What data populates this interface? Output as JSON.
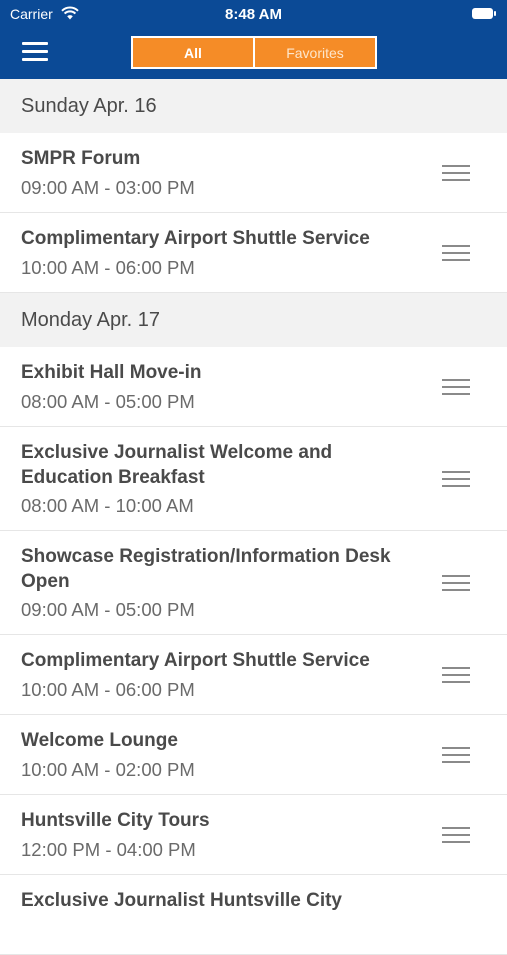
{
  "status_bar": {
    "carrier": "Carrier",
    "time": "8:48 AM"
  },
  "nav": {
    "tabs": [
      {
        "label": "All",
        "selected": true
      },
      {
        "label": "Favorites",
        "selected": false
      }
    ]
  },
  "colors": {
    "header": "#0b4a96",
    "accent": "#f58c27"
  },
  "sections": [
    {
      "label": "Sunday Apr. 16",
      "items": [
        {
          "title": "SMPR Forum",
          "time": "09:00 AM - 03:00 PM"
        },
        {
          "title": "Complimentary Airport Shuttle Service",
          "time": "10:00 AM - 06:00 PM"
        }
      ]
    },
    {
      "label": "Monday Apr. 17",
      "items": [
        {
          "title": "Exhibit Hall Move-in",
          "time": "08:00 AM - 05:00 PM"
        },
        {
          "title": "Exclusive Journalist Welcome and Education Breakfast",
          "time": "08:00 AM - 10:00 AM"
        },
        {
          "title": "Showcase Registration/Information Desk Open",
          "time": "09:00 AM - 05:00 PM"
        },
        {
          "title": "Complimentary Airport Shuttle Service",
          "time": "10:00 AM - 06:00 PM"
        },
        {
          "title": "Welcome Lounge",
          "time": "10:00 AM - 02:00 PM"
        },
        {
          "title": "Huntsville City Tours",
          "time": "12:00 PM - 04:00 PM"
        },
        {
          "title": "Exclusive Journalist Huntsville City",
          "time": ""
        }
      ]
    }
  ]
}
